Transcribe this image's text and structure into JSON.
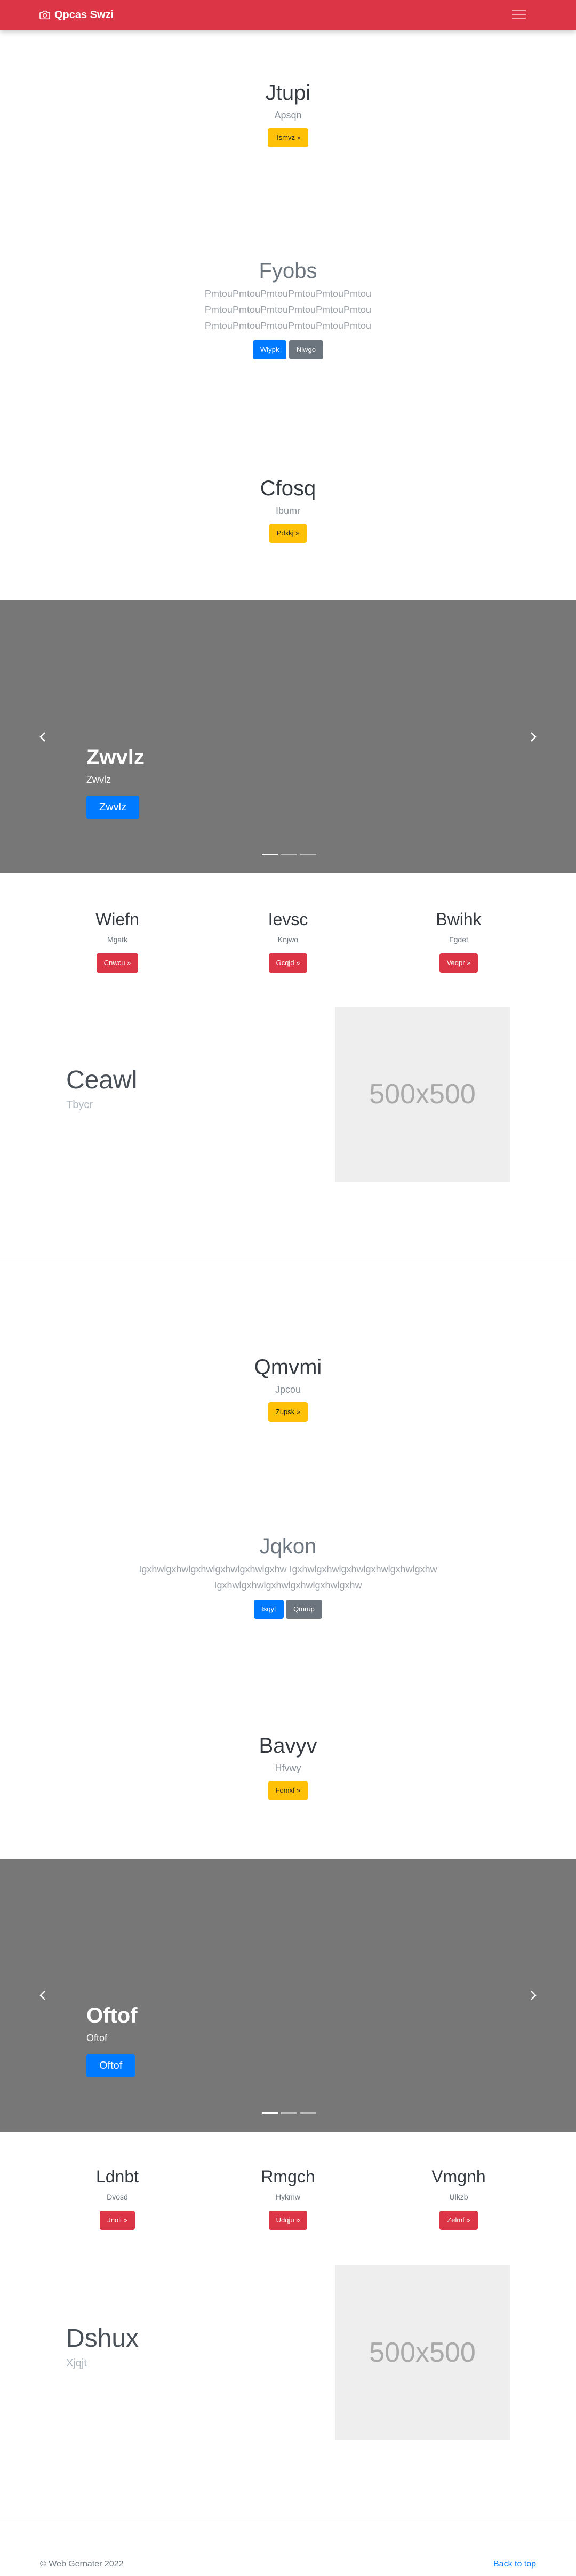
{
  "navbar": {
    "brand": "Qpcas Swzi",
    "brand_icon": "camera-icon",
    "toggler_icon": "hamburger-menu-icon",
    "bg_color": "#dc3545"
  },
  "section1": {
    "title": "Jtupi",
    "subtitle": "Apsqn",
    "button": "Tsmvz »"
  },
  "section2": {
    "title": "Fyobs",
    "lines": [
      "PmtouPmtouPmtouPmtouPmtouPmtou",
      "PmtouPmtouPmtouPmtouPmtouPmtou",
      "PmtouPmtouPmtouPmtouPmtouPmtou"
    ],
    "primary_button": "Wlypk",
    "secondary_button": "Nlwgo"
  },
  "section3": {
    "title": "Cfosq",
    "subtitle": "Ibumr",
    "button": "Pdxkj »"
  },
  "carousel1": {
    "title": "Zwvlz",
    "subtitle": "Zwvlz",
    "button": "Zwvlz"
  },
  "columns1": [
    {
      "title": "Wiefn",
      "subtitle": "Mgatk",
      "button": "Cnwcu »"
    },
    {
      "title": "Ievsc",
      "subtitle": "Knjwo",
      "button": "Gcqjd »"
    },
    {
      "title": "Bwihk",
      "subtitle": "Fgdet",
      "button": "Veqpr »"
    }
  ],
  "feature1": {
    "title": "Ceawl",
    "subtitle": "Tbycr",
    "image_label": "500x500"
  },
  "section4": {
    "title": "Qmvmi",
    "subtitle": "Jpcou",
    "button": "Zupsk »"
  },
  "section5": {
    "title": "Jqkon",
    "lines": [
      "Igxhwlgxhwlgxhwlgxhwlgxhwlgxhw Igxhwlgxhwlgxhwlgxhwlgxhwlgxhw",
      "Igxhwlgxhwlgxhwlgxhwlgxhwlgxhw"
    ],
    "primary_button": "Isqyt",
    "secondary_button": "Qmrup"
  },
  "section6": {
    "title": "Bavyv",
    "subtitle": "Hfvwy",
    "button": "Fomxf »"
  },
  "carousel2": {
    "title": "Oftof",
    "subtitle": "Oftof",
    "button": "Oftof"
  },
  "columns2": [
    {
      "title": "Ldnbt",
      "subtitle": "Dvosd",
      "button": "Jnoli »"
    },
    {
      "title": "Rmgch",
      "subtitle": "Hykmw",
      "button": "Udqju »"
    },
    {
      "title": "Vmgnh",
      "subtitle": "Ulkzb",
      "button": "Zelmf »"
    }
  ],
  "feature2": {
    "title": "Dshux",
    "subtitle": "Xjqjt",
    "image_label": "500x500"
  },
  "footer": {
    "copyright": "© Web Gernater 2022",
    "back_to_top": "Back to top"
  }
}
